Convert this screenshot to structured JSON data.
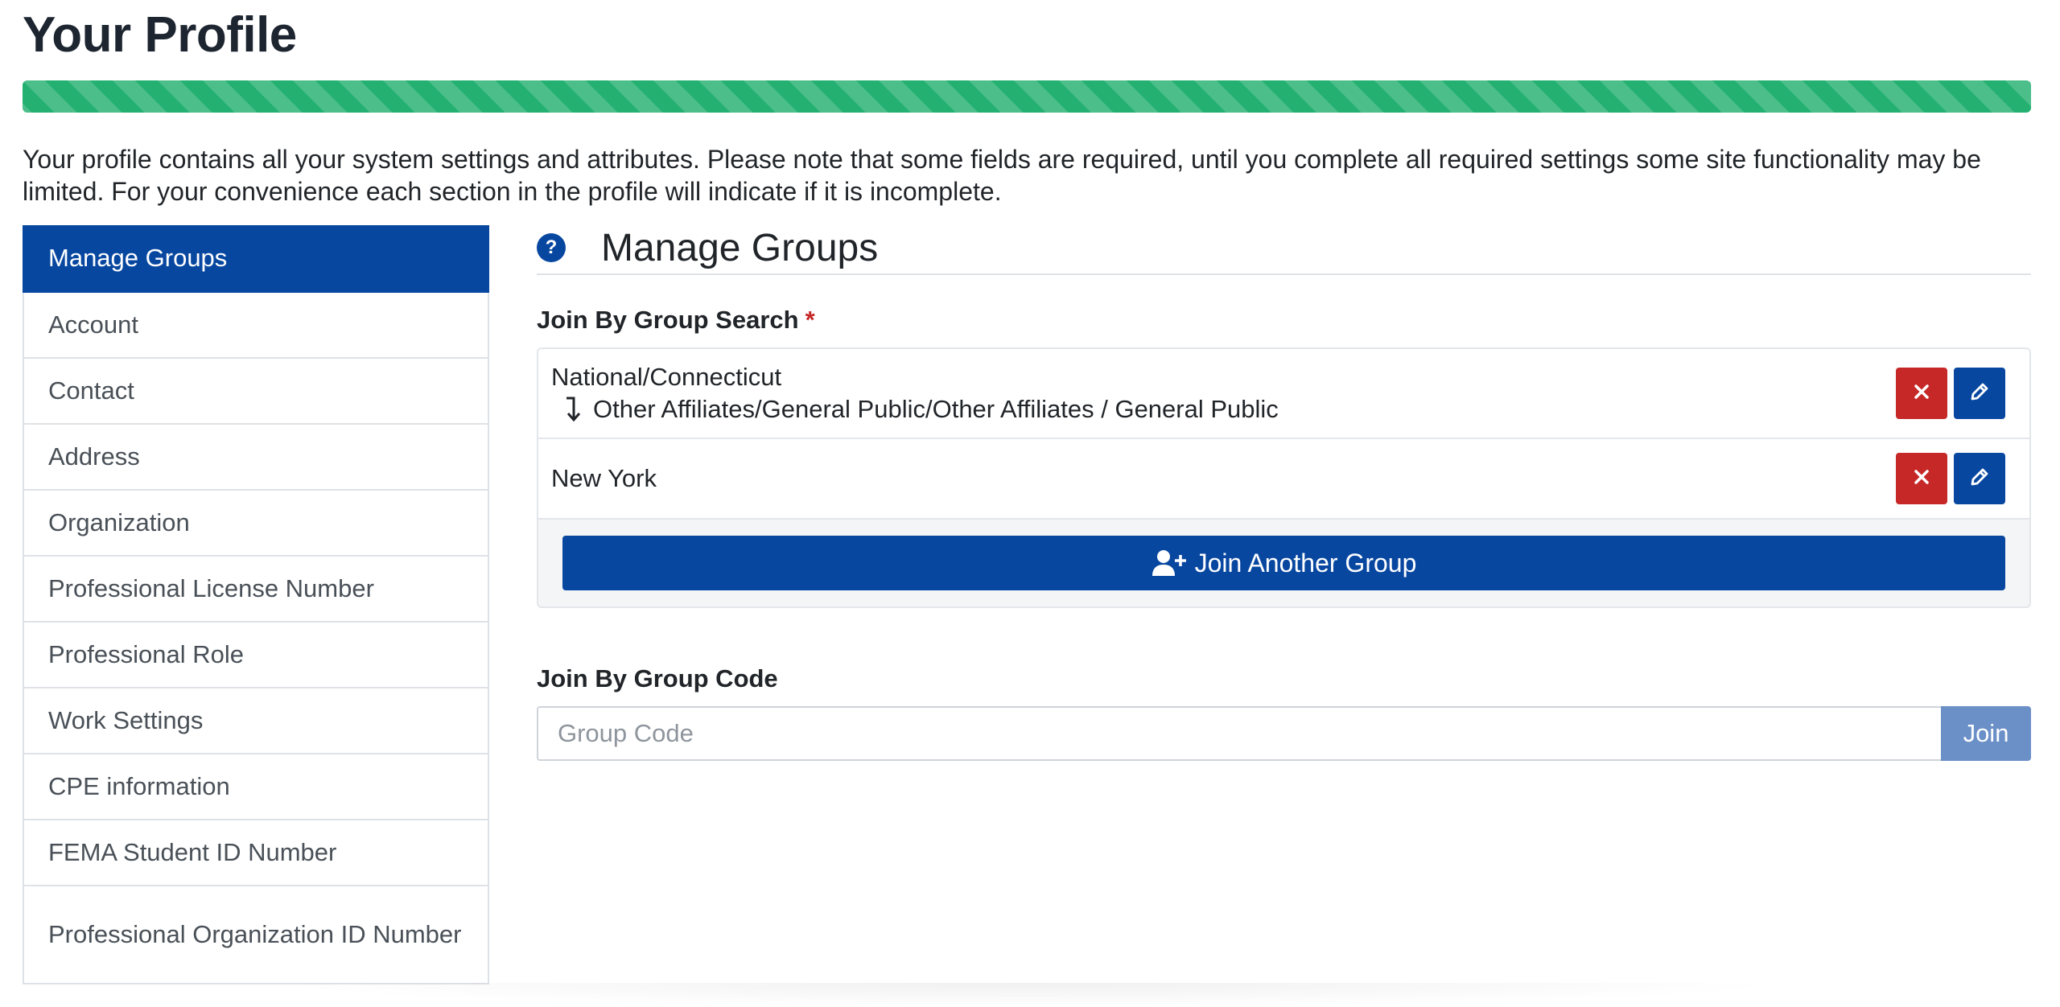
{
  "page": {
    "title": "Your Profile",
    "progress_percent": 100,
    "intro": "Your profile contains all your system settings and attributes. Please note that some fields are required, until you complete all required settings some site functionality may be limited. For your convenience each section in the profile will indicate if it is incomplete."
  },
  "sidebar": {
    "items": [
      {
        "label": "Manage Groups",
        "active": true
      },
      {
        "label": "Account"
      },
      {
        "label": "Contact"
      },
      {
        "label": "Address"
      },
      {
        "label": "Organization"
      },
      {
        "label": "Professional License Number"
      },
      {
        "label": "Professional Role"
      },
      {
        "label": "Work Settings"
      },
      {
        "label": "CPE information"
      },
      {
        "label": "FEMA Student ID Number"
      },
      {
        "label": "Professional Organization ID Number"
      }
    ]
  },
  "main": {
    "help_icon_label": "?",
    "title": "Manage Groups",
    "group_search": {
      "label": "Join By Group Search",
      "required_mark": "*",
      "groups": [
        {
          "name": "National/Connecticut",
          "sub": "Other Affiliates/General Public/Other Affiliates / General Public"
        },
        {
          "name": "New York"
        }
      ],
      "join_another_label": "Join Another Group"
    },
    "group_code": {
      "label": "Join By Group Code",
      "placeholder": "Group Code",
      "value": "",
      "join_label": "Join"
    }
  },
  "colors": {
    "primary": "#0847a0",
    "danger": "#c62828",
    "success": "#23b070",
    "join_disabled": "#6b90c8"
  },
  "icons": {
    "help": "question-circle-icon",
    "remove": "times-icon",
    "edit": "pencil-icon",
    "join_another": "user-plus-icon",
    "child": "turn-down-arrow-icon"
  }
}
